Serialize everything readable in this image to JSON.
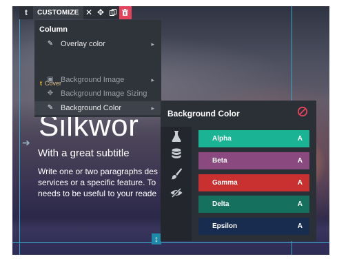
{
  "toolbar": {
    "type_letter": "t",
    "label": "CUSTOMIZE",
    "close_glyph": "✕",
    "move_glyph": "✥",
    "duplicate_glyph": "⧉",
    "delete_glyph": "🗑",
    "delete_color": "#e4435b"
  },
  "hero": {
    "title": "Silkwor",
    "subtitle": "With a great subtitle",
    "paragraph_lines": [
      "Write one or two paragraphs des",
      "services or a specific feature. To",
      "needs to be useful to your reade"
    ],
    "left_arrow": "➔",
    "resize_glyph": "↕"
  },
  "menu": {
    "header": "Column",
    "items": [
      {
        "label": "Overlay color",
        "icon": "eyedropper-icon",
        "glyph": "✎",
        "has_submenu": true,
        "dim": false
      },
      {
        "label": "Background Image",
        "icon": "image-icon",
        "glyph": "▣",
        "has_submenu": true,
        "dim": true
      },
      {
        "label": "Background Image Sizing",
        "icon": "move-icon",
        "glyph": "✥",
        "has_submenu": false,
        "dim": true
      },
      {
        "label": "Background Color",
        "icon": "eyedropper-icon",
        "glyph": "✎",
        "has_submenu": true,
        "dim": false
      }
    ],
    "subsection": {
      "letter": "t",
      "label": "Cover"
    },
    "submenu_caret": "▸"
  },
  "bg_panel": {
    "title": "Background Color",
    "none_color": "#e4435b",
    "tabs": [
      "flask-icon",
      "database-icon",
      "brush-icon",
      "eye-slash-icon"
    ],
    "swatches": [
      {
        "name": "Alpha",
        "color": "#1ab394",
        "char": "A"
      },
      {
        "name": "Beta",
        "color": "#8a4a80",
        "char": "A"
      },
      {
        "name": "Gamma",
        "color": "#c8312f",
        "char": "A"
      },
      {
        "name": "Delta",
        "color": "#15705e",
        "char": "A"
      },
      {
        "name": "Epsilon",
        "color": "#182c4f",
        "char": "A"
      }
    ]
  }
}
